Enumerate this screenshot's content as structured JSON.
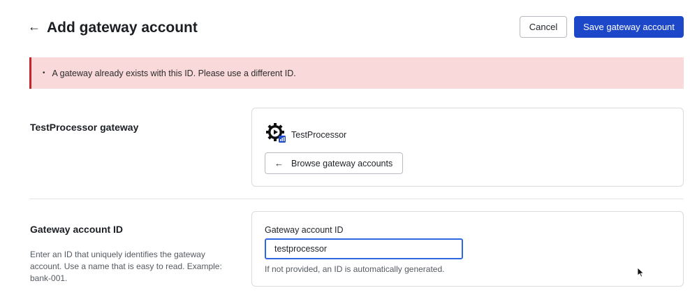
{
  "header": {
    "back_icon": "arrow-left-icon",
    "title": "Add gateway account",
    "cancel_label": "Cancel",
    "save_label": "Save gateway account"
  },
  "error": {
    "bullet": "•",
    "message": "A gateway already exists with this ID. Please use a different ID."
  },
  "gateway_section": {
    "label": "TestProcessor gateway",
    "processor_icon": "gear-play-icon",
    "processor_name": "TestProcessor",
    "browse_label": "Browse gateway accounts"
  },
  "id_section": {
    "label": "Gateway account ID",
    "description": "Enter an ID that uniquely identifies the gateway account. Use a name that is easy to read. Example: bank-001.",
    "field_label": "Gateway account ID",
    "field_value": "testprocessor",
    "helper": "If not provided, an ID is automatically generated."
  },
  "colors": {
    "primary": "#1c47c9",
    "error_bg": "#f9d9da",
    "error_border": "#c9232b",
    "focus": "#2f68e0"
  }
}
